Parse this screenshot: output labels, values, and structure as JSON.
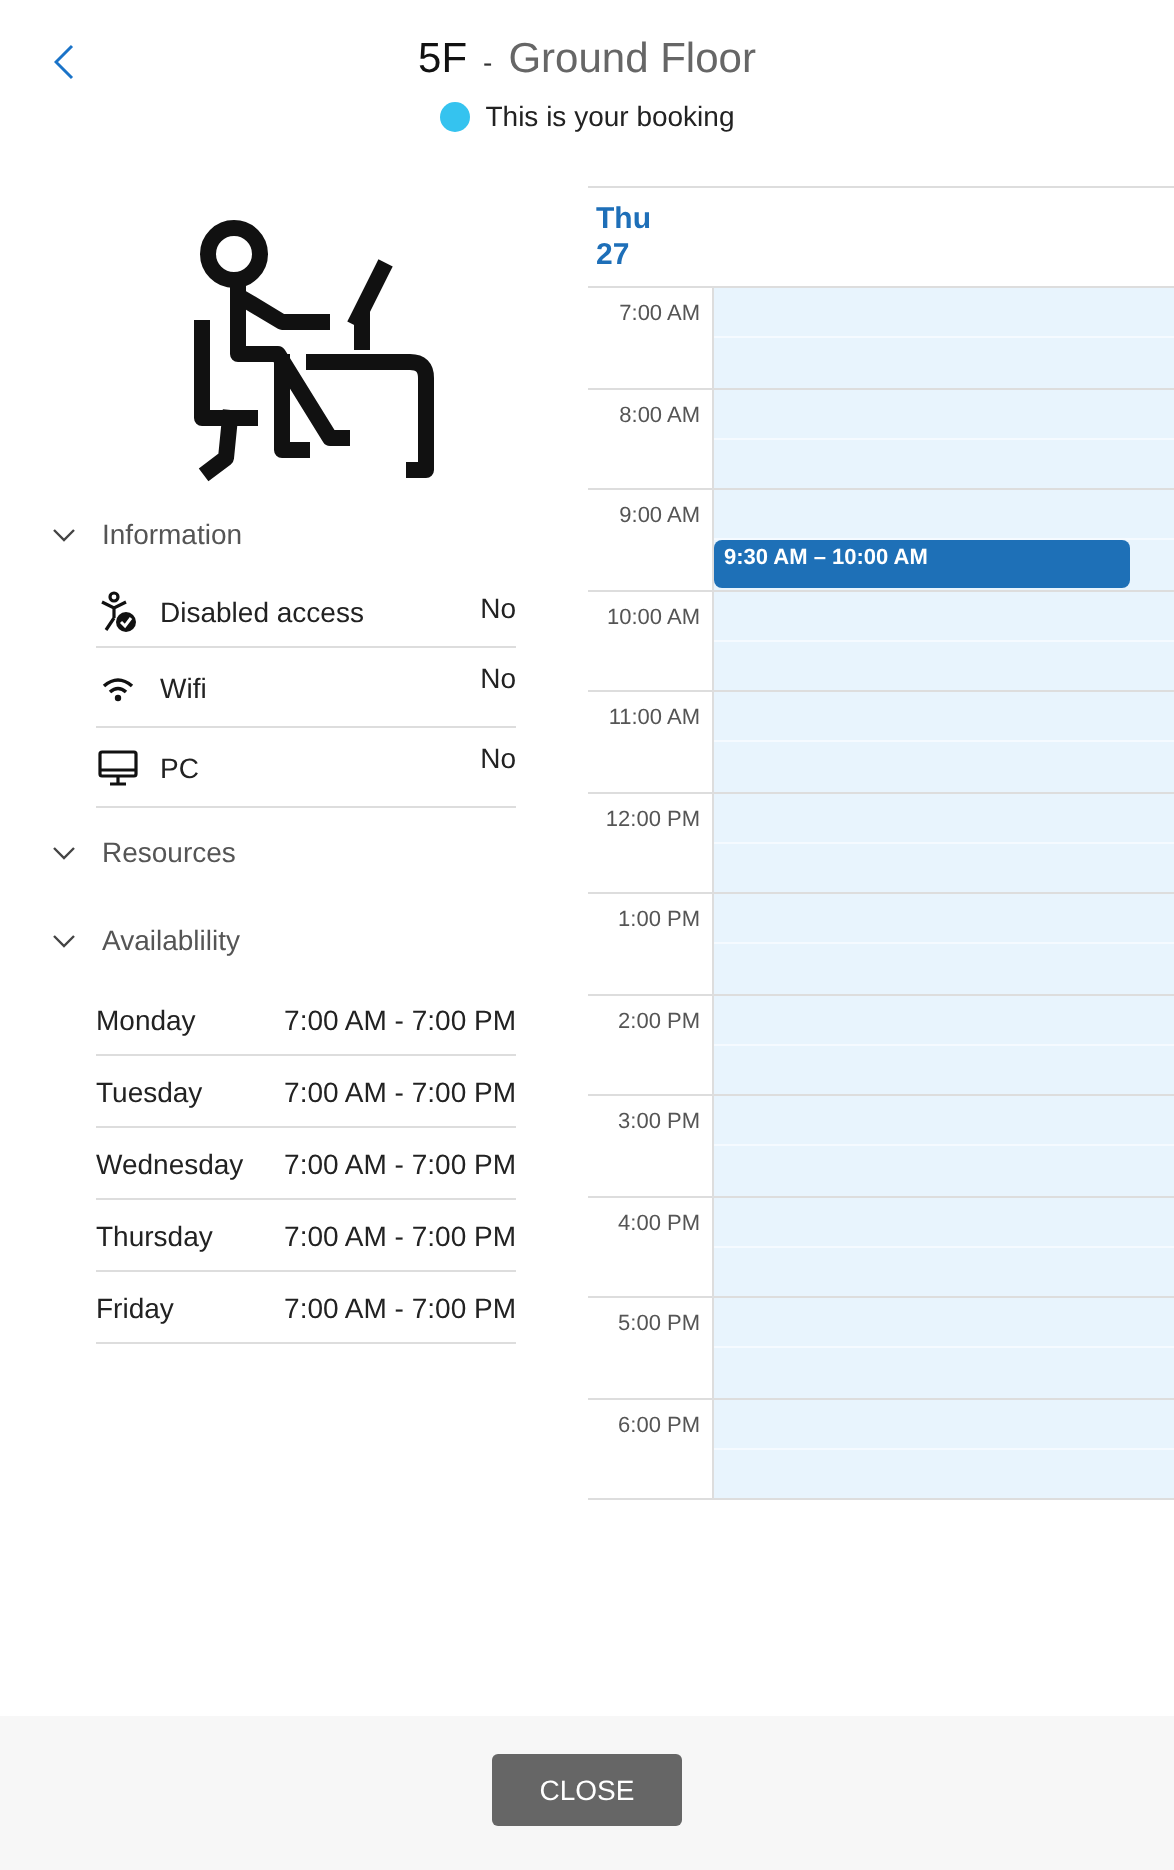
{
  "header": {
    "code": "5F",
    "separator": "-",
    "floor": "Ground Floor"
  },
  "legend": {
    "label": "This is your booking",
    "color": "#35c3ef"
  },
  "sections": [
    {
      "title": "Information",
      "kind": "features",
      "rows": [
        {
          "kind": "accessible",
          "label": "Disabled access",
          "value": "No"
        },
        {
          "kind": "wifi",
          "label": "Wifi",
          "value": "No"
        },
        {
          "kind": "monitor",
          "label": "PC",
          "value": "No"
        }
      ]
    },
    {
      "title": "Resources",
      "kind": "empty"
    },
    {
      "title": "Availablility",
      "kind": "hours",
      "rows": [
        {
          "label": "Monday",
          "value": "7:00 AM - 7:00 PM"
        },
        {
          "label": "Tuesday",
          "value": "7:00 AM - 7:00 PM"
        },
        {
          "label": "Wednesday",
          "value": "7:00 AM - 7:00 PM"
        },
        {
          "label": "Thursday",
          "value": "7:00 AM - 7:00 PM"
        },
        {
          "label": "Friday",
          "value": "7:00 AM - 7:00 PM"
        }
      ]
    }
  ],
  "calendar": {
    "day": "Thu",
    "date": "27",
    "hours": [
      {
        "label": "7:00 AM"
      },
      {
        "label": "8:00 AM"
      },
      {
        "label": "9:00 AM",
        "event": {
          "label": "9:30 AM – 10:00 AM"
        }
      },
      {
        "label": "10:00 AM"
      },
      {
        "label": "11:00 AM"
      },
      {
        "label": "12:00 PM"
      },
      {
        "label": "1:00 PM"
      },
      {
        "label": "2:00 PM"
      },
      {
        "label": "3:00 PM"
      },
      {
        "label": "4:00 PM"
      },
      {
        "label": "5:00 PM"
      },
      {
        "label": "6:00 PM"
      }
    ]
  },
  "close_button": "CLOSE"
}
